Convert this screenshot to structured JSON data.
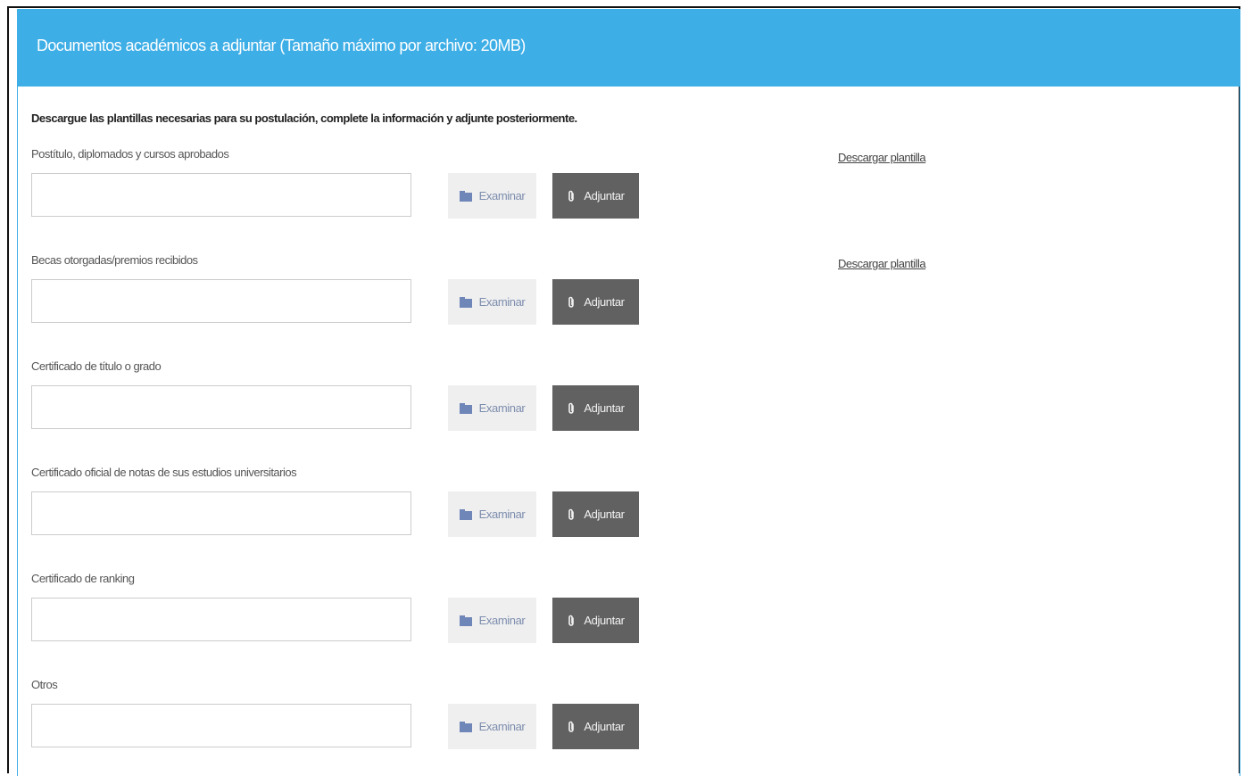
{
  "panel": {
    "title": "Documentos académicos a adjuntar (Tamaño máximo por archivo: 20MB)",
    "instructions": "Descargue las plantillas necesarias para su postulación, complete la información y adjunte posteriormente.",
    "header_color": "#3eaee6"
  },
  "documents": [
    {
      "label": "Postítulo, diplomados y cursos aprobados",
      "value": "",
      "examinar_label": "Examinar",
      "adjuntar_label": "Adjuntar",
      "download_label": "Descargar plantilla"
    },
    {
      "label": "Becas otorgadas/premios recibidos",
      "value": "",
      "examinar_label": "Examinar",
      "adjuntar_label": "Adjuntar",
      "download_label": "Descargar plantilla"
    },
    {
      "label": "Certificado de título o grado",
      "value": "",
      "examinar_label": "Examinar",
      "adjuntar_label": "Adjuntar"
    },
    {
      "label": "Certificado oficial de notas de sus estudios universitarios",
      "value": "",
      "examinar_label": "Examinar",
      "adjuntar_label": "Adjuntar"
    },
    {
      "label": "Certificado de ranking",
      "value": "",
      "examinar_label": "Examinar",
      "adjuntar_label": "Adjuntar"
    },
    {
      "label": "Otros",
      "value": "",
      "examinar_label": "Examinar",
      "adjuntar_label": "Adjuntar"
    }
  ],
  "icons": {
    "examinar_icon": "folder-icon",
    "adjuntar_icon": "paperclip-icon"
  }
}
